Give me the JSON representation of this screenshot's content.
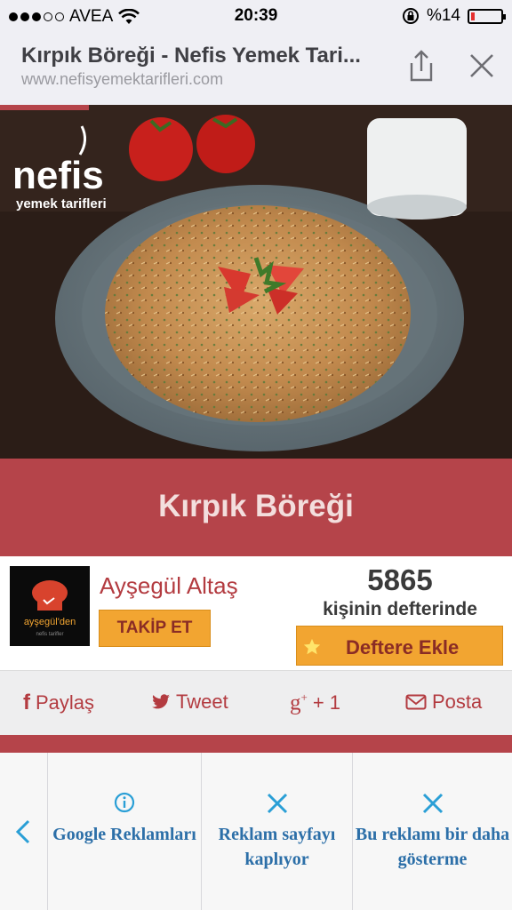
{
  "status_bar": {
    "carrier": "AVEA",
    "time": "20:39",
    "battery_text": "%14",
    "battery_level": 0.14
  },
  "browser": {
    "title": "Kırpık Böreği - Nefis Yemek Tari...",
    "url": "www.nefisyemektarifleri.com",
    "share_icon": "share-icon",
    "close_icon": "close-icon"
  },
  "hero": {
    "logo_main": "nefis",
    "logo_sub": "yemek tarifleri"
  },
  "recipe": {
    "title": "Kırpık Böreği"
  },
  "author": {
    "name": "Ayşegül Altaş",
    "follow_label": "TAKİP ET",
    "avatar_text": "ayşegül'den",
    "avatar_subtext": "nefis tarifler"
  },
  "stats": {
    "count": "5865",
    "count_label": "kişinin defterinde",
    "add_label": "Deftere Ekle"
  },
  "share": {
    "facebook": "Paylaş",
    "twitter": "Tweet",
    "google": "+ 1",
    "mail": "Posta"
  },
  "ad_bar": {
    "google_label": "Google Reklamları",
    "report_label": "Reklam sayfayı kaplıyor",
    "hide_label": "Bu reklamı bir daha gösterme"
  },
  "colors": {
    "brand_red": "#b5444a",
    "accent_orange": "#f2a531",
    "link_blue": "#2c6fa8"
  }
}
